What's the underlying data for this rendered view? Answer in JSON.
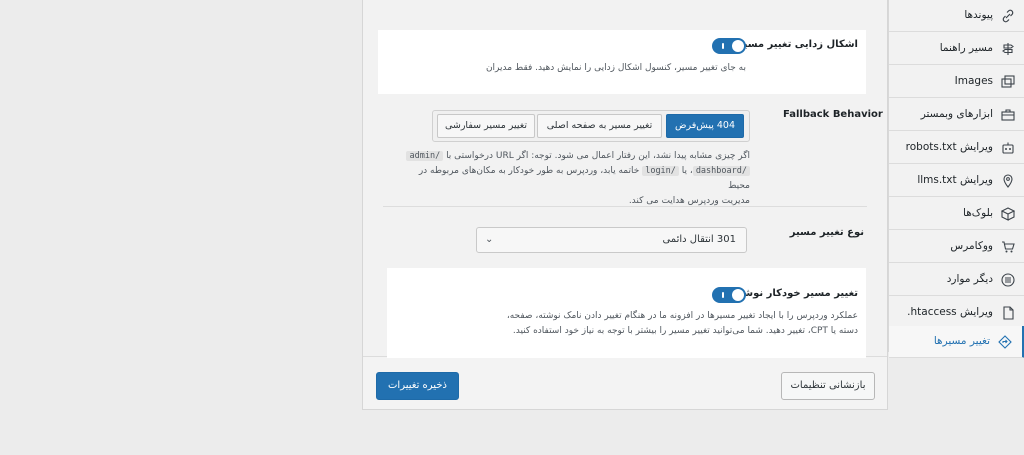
{
  "sidebar": {
    "items": [
      {
        "label": "پیوندها",
        "icon": "link-icon"
      },
      {
        "label": "مسیر راهنما",
        "icon": "signpost-icon"
      },
      {
        "label": "Images",
        "icon": "images-icon"
      },
      {
        "label": "ابزارهای وبمستر",
        "icon": "toolbox-icon"
      },
      {
        "label": "ویرایش robots.txt",
        "icon": "robot-icon"
      },
      {
        "label": "ویرایش llms.txt",
        "icon": "pin-icon"
      },
      {
        "label": "بلوک‌ها",
        "icon": "cube-icon"
      },
      {
        "label": "ووکامرس",
        "icon": "cart-icon"
      },
      {
        "label": "دیگر موارد",
        "icon": "circle-list-icon"
      },
      {
        "label": "ویرایش htaccess.",
        "icon": "file-icon"
      },
      {
        "label": "تغییر مسیرها",
        "icon": "redirect-icon",
        "active": true
      }
    ]
  },
  "settings": {
    "debug_redirects": {
      "label": "اشکال زدایی تغییر مسیرها",
      "enabled": true,
      "description": "به جای تغییر مسیر، کنسول اشکال زدایی را نمایش دهید. فقط مدیران"
    },
    "fallback": {
      "label": "Fallback Behavior",
      "options": [
        "404 پیش‌فرض",
        "تغییر مسیر به صفحه اصلی",
        "تغییر مسیر سفارشی"
      ],
      "selected": "404 پیش‌فرض",
      "desc_line1_a": "اگر چیزی مشابه پیدا نشد، این رفتار اعمال می شود. توجه: اگر URL درخواستی با",
      "code_admin": "/admin",
      "code_login": "/login",
      "code_dashboard": "/dashboard",
      "desc_line2_mid": "، یا",
      "desc_line2_end": "خاتمه یابد، وردپرس به طور خودکار به مکان‌های مربوطه در محیط",
      "desc_line3": "مدیریت وردپرس هدایت می کند."
    },
    "redirect_type": {
      "label": "نوع تغییر مسیر",
      "value": "301 انتقال دائمی"
    },
    "auto_redirect": {
      "label": "تغییر مسیر خودکار نوشته",
      "enabled": true,
      "desc_line1": "عملکرد وردپرس را با ایجاد تغییر مسیرها در افزونه ما در هنگام تغییر دادن نامک نوشته، صفحه،",
      "desc_line2": "دسته یا CPT، تغییر دهید. شما می‌توانید تغییر مسیر را بیشتر با توجه به نیاز خود استفاده کنید."
    }
  },
  "footer": {
    "save_label": "ذخیره تغییرات",
    "reset_label": "بازنشانی تنظیمات"
  },
  "colors": {
    "accent": "#2271b1",
    "background": "#ececec"
  }
}
